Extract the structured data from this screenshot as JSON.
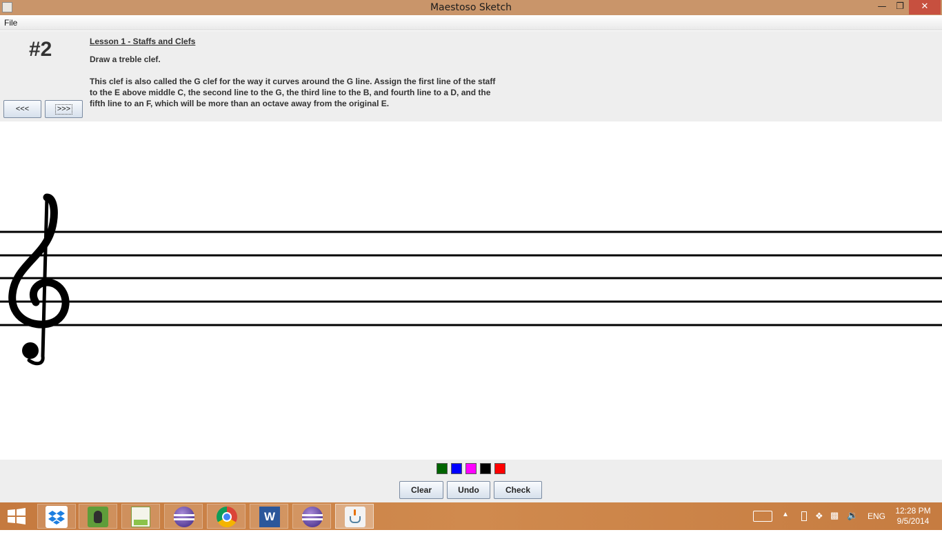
{
  "window": {
    "title": "Maestoso Sketch",
    "minimize_icon": "minimize-icon",
    "maximize_icon": "restore-icon",
    "close_icon": "close-icon"
  },
  "menubar": {
    "items": [
      {
        "label": "File"
      }
    ]
  },
  "lesson": {
    "number": "#2",
    "heading": "Lesson 1 - Staffs and Clefs",
    "instruction": "Draw a treble clef.",
    "description": "This clef is also called the G clef for the way it curves around the G line. Assign the first line of the staff to the E above middle C, the second line to the G, the third line to the B, and fourth line to a D, and the fifth line to an F, which will be more than an octave away from the original E.",
    "prev_label": "<<<",
    "next_label": ">>>"
  },
  "canvas": {
    "staff_lines": 5,
    "clef": "treble-clef",
    "clef_glyph": "𝄞"
  },
  "palette": {
    "colors": [
      "#006400",
      "#0000ff",
      "#ff00ff",
      "#000000",
      "#ff0000"
    ]
  },
  "actions": {
    "clear_label": "Clear",
    "undo_label": "Undo",
    "check_label": "Check"
  },
  "taskbar": {
    "apps": [
      "dropbox",
      "evernote",
      "notepad-plus-plus",
      "eclipse",
      "chrome",
      "word",
      "eclipse",
      "java"
    ],
    "language": "ENG",
    "time": "12:28 PM",
    "date": "9/5/2014"
  }
}
